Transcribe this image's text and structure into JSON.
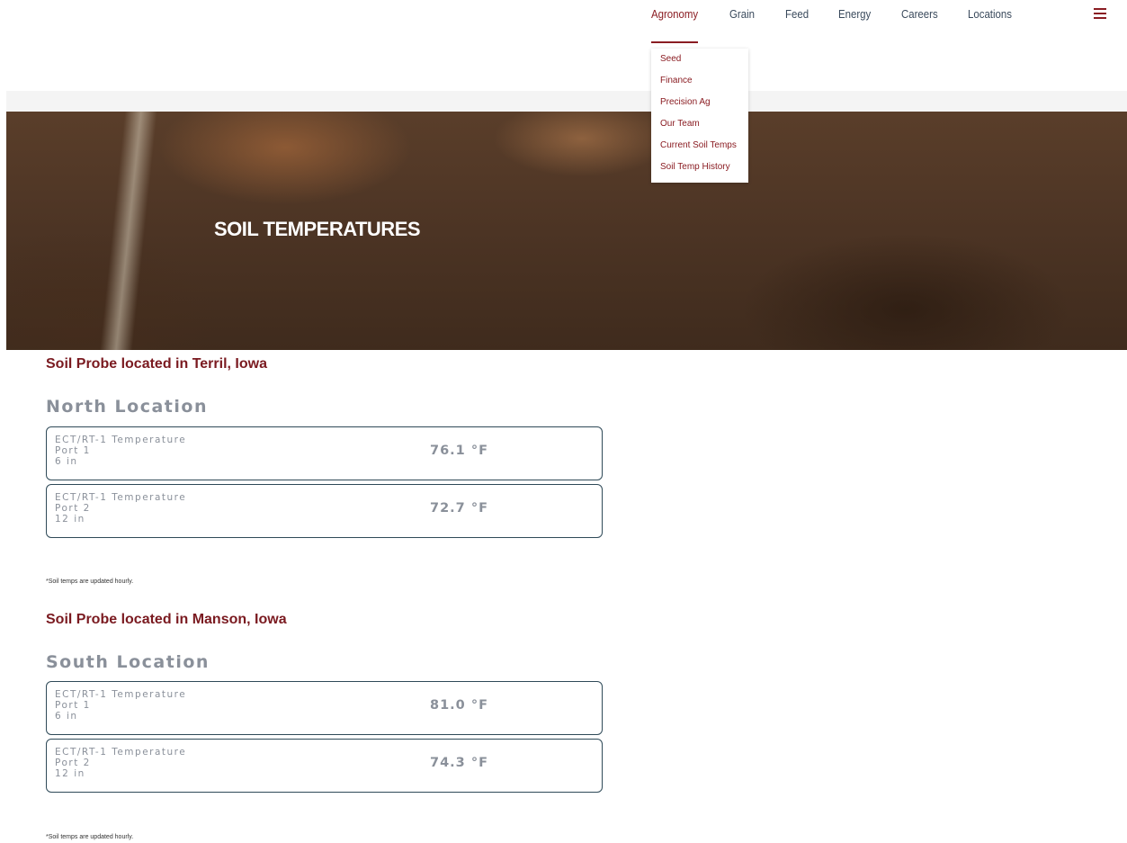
{
  "nav": {
    "items": [
      "Agronomy",
      "Grain",
      "Feed",
      "Energy",
      "Careers",
      "Locations"
    ],
    "active": "Agronomy",
    "menu_icon": "hamburger-menu-icon"
  },
  "dropdown": {
    "items": [
      "Seed",
      "Finance",
      "Precision Ag",
      "Our Team",
      "Current Soil Temps",
      "Soil Temp History"
    ]
  },
  "hero": {
    "title": "SOIL TEMPERATURES"
  },
  "sections": [
    {
      "probe_title": "Soil Probe located in Terril, Iowa",
      "location_title": "North Location",
      "sensors": [
        {
          "name": "ECT/RT-1 Temperature",
          "port": "Port 1",
          "depth": "6 in",
          "value": "76.1 °F"
        },
        {
          "name": "ECT/RT-1 Temperature",
          "port": "Port 2",
          "depth": "12 in",
          "value": "72.7 °F"
        }
      ],
      "footnote": "*Soil temps are updated hourly."
    },
    {
      "probe_title": "Soil Probe located in Manson, Iowa",
      "location_title": "South Location",
      "sensors": [
        {
          "name": "ECT/RT-1 Temperature",
          "port": "Port 1",
          "depth": "6 in",
          "value": "81.0 °F"
        },
        {
          "name": "ECT/RT-1 Temperature",
          "port": "Port 2",
          "depth": "12 in",
          "value": "74.3 °F"
        }
      ],
      "footnote": "*Soil temps are updated hourly."
    }
  ],
  "colors": {
    "brand": "#8a1c22",
    "nav_text": "#3a4a5c",
    "muted_text": "#8a909a",
    "box_border": "#2f4a58"
  }
}
